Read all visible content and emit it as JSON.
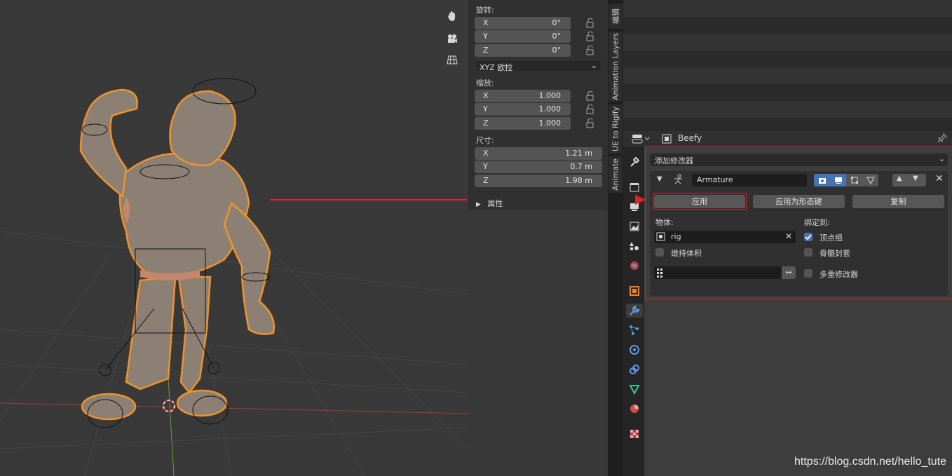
{
  "npanel": {
    "rotation_label": "旋转:",
    "rotation": [
      {
        "axis": "X",
        "value": "0°"
      },
      {
        "axis": "Y",
        "value": "0°"
      },
      {
        "axis": "Z",
        "value": "0°"
      }
    ],
    "rotation_mode": "XYZ 欧拉",
    "scale_label": "缩放:",
    "scale": [
      {
        "axis": "X",
        "value": "1.000"
      },
      {
        "axis": "Y",
        "value": "1.000"
      },
      {
        "axis": "Z",
        "value": "1.000"
      }
    ],
    "dimensions_label": "尺寸:",
    "dimensions": [
      {
        "axis": "X",
        "value": "1.21 m"
      },
      {
        "axis": "Y",
        "value": "0.7 m"
      },
      {
        "axis": "Z",
        "value": "1.98 m"
      }
    ],
    "properties_label": "属性"
  },
  "vtabs": [
    "编辑",
    "Animation Layers",
    "UE to Rigify",
    "Animate"
  ],
  "properties": {
    "object_name": "Beefy",
    "add_modifier": "添加修改器",
    "modifier_name": "Armature",
    "apply": "应用",
    "apply_as_shapekey": "应用为形态键",
    "copy": "复制",
    "object_label": "物体:",
    "object_value": "rig",
    "preserve_volume": "维持体积",
    "bind_to_label": "绑定到:",
    "vertex_groups": "顶点组",
    "bone_envelopes": "骨骼封套",
    "multi_modifier": "多重修改器"
  },
  "watermark": "https://blog.csdn.net/hello_tute",
  "colors": {
    "selection_outline": "#f0922c",
    "annotation_red": "#e0202a",
    "active_blue": "#4772b3"
  }
}
